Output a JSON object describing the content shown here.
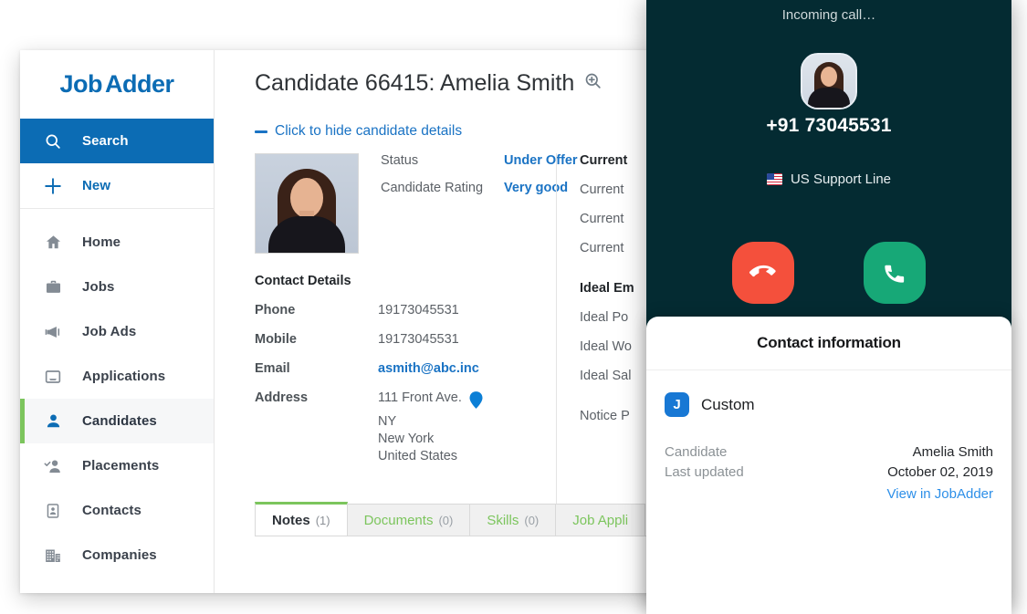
{
  "app": {
    "brand_part1": "Job",
    "brand_part2": "Adder",
    "nav_top": [
      {
        "label": "Search",
        "icon": "search-icon"
      },
      {
        "label": "New",
        "icon": "plus-icon"
      }
    ],
    "nav_main": [
      {
        "label": "Home",
        "icon": "home-icon"
      },
      {
        "label": "Jobs",
        "icon": "briefcase-icon"
      },
      {
        "label": "Job Ads",
        "icon": "megaphone-icon"
      },
      {
        "label": "Applications",
        "icon": "inbox-icon"
      },
      {
        "label": "Candidates",
        "icon": "person-icon"
      },
      {
        "label": "Placements",
        "icon": "person-check-icon"
      },
      {
        "label": "Contacts",
        "icon": "contact-card-icon"
      },
      {
        "label": "Companies",
        "icon": "building-icon"
      }
    ]
  },
  "page": {
    "title": "Candidate 66415: Amelia Smith",
    "toggle_details": "Click to hide candidate details"
  },
  "summary": {
    "rows": [
      {
        "key": "Status",
        "value": "Under Offer"
      },
      {
        "key": "Candidate Rating",
        "value": "Very good"
      }
    ]
  },
  "contact_details": {
    "heading": "Contact Details",
    "phone_label": "Phone",
    "phone_value": "19173045531",
    "mobile_label": "Mobile",
    "mobile_value": "19173045531",
    "email_label": "Email",
    "email_value": "asmith@abc.inc",
    "address_label": "Address",
    "address_lines": [
      "111 Front Ave.",
      "NY",
      "New York",
      "United States"
    ]
  },
  "employment": {
    "rows": [
      {
        "label": "Current",
        "bold": true
      },
      {
        "label": "Current",
        "bold": false
      },
      {
        "label": "Current",
        "bold": false
      },
      {
        "label": "Current",
        "bold": false
      },
      {
        "label": "Ideal Em",
        "bold": true
      },
      {
        "label": "Ideal Po",
        "bold": false
      },
      {
        "label": "Ideal Wo",
        "bold": false
      },
      {
        "label": "Ideal Sal",
        "bold": false
      },
      {
        "label": "Notice P",
        "bold": false
      }
    ]
  },
  "tabs": [
    {
      "label": "Notes",
      "count": "(1)",
      "active": true
    },
    {
      "label": "Documents",
      "count": "(0)",
      "active": false
    },
    {
      "label": "Skills",
      "count": "(0)",
      "active": false
    },
    {
      "label": "Job Appli",
      "count": "",
      "active": false
    }
  ],
  "call": {
    "status": "Incoming call…",
    "number": "+91 73045531",
    "line_name": "US Support Line",
    "decline_label": "decline-call",
    "accept_label": "accept-call"
  },
  "contact_info": {
    "title": "Contact information",
    "app_badge": "J",
    "app_name": "Custom",
    "rows": [
      {
        "key": "Candidate",
        "value": "Amelia Smith"
      },
      {
        "key": "Last updated",
        "value": "October 02, 2019"
      }
    ],
    "link": "View in JobAdder"
  },
  "colors": {
    "brand_blue": "#0c6cb4",
    "accent_green": "#7cc55d",
    "link_blue": "#1a73c4",
    "call_bg": "#042b32",
    "decline_red": "#f4503c",
    "accept_green": "#17a877"
  }
}
